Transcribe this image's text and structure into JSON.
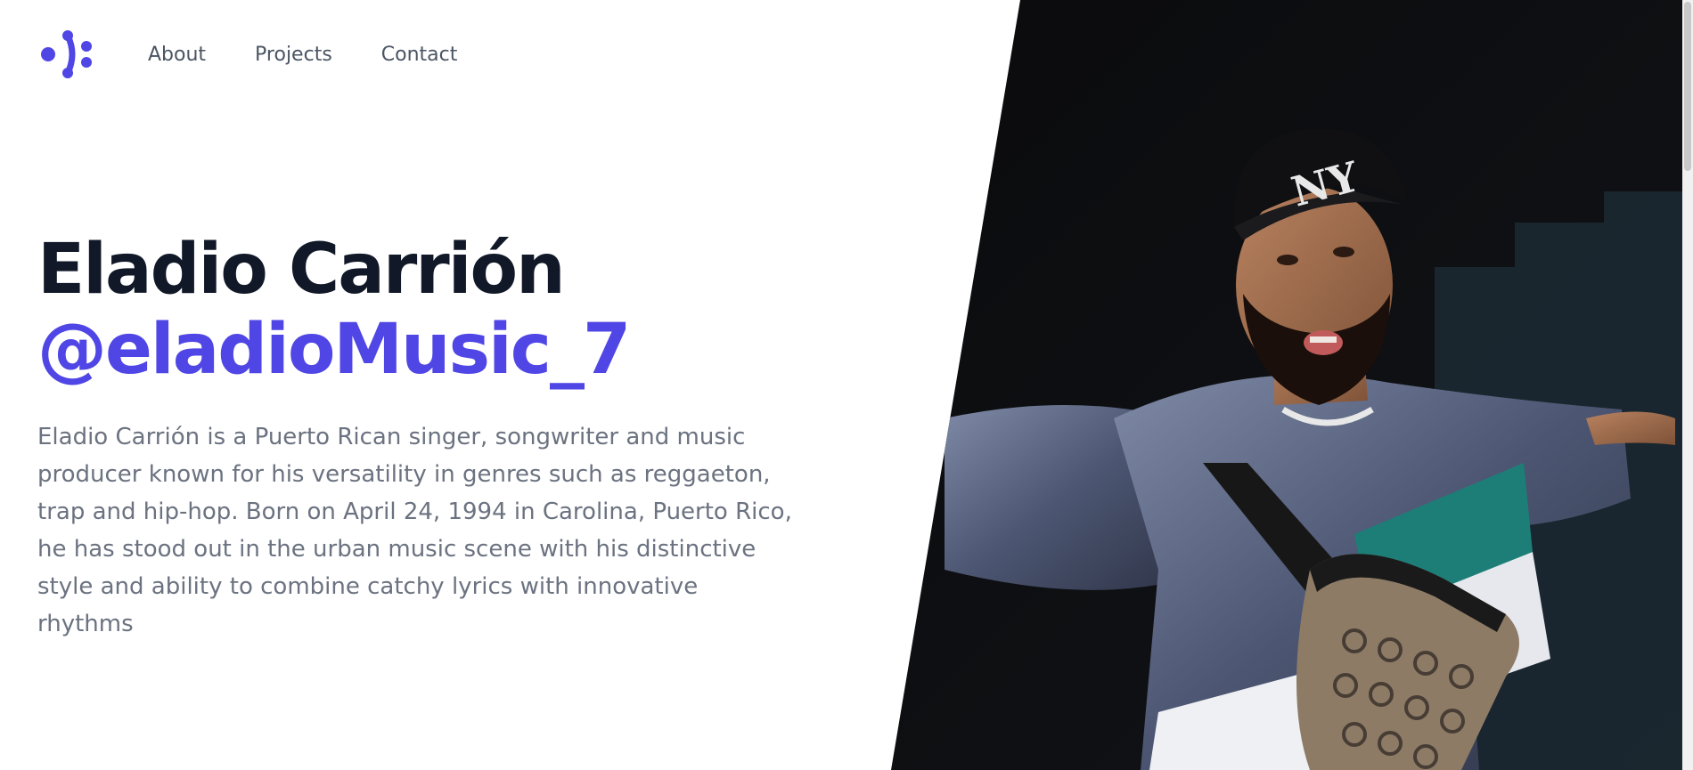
{
  "nav": {
    "logo_icon": "dots-logo-icon",
    "links": [
      {
        "label": "About"
      },
      {
        "label": "Projects"
      },
      {
        "label": "Contact"
      }
    ]
  },
  "hero": {
    "name": "Eladio Carrión",
    "handle": "@eladioMusic_7",
    "description": "Eladio Carrión is a Puerto Rican singer, songwriter and music producer known for his versatility in genres such as reggaeton, trap and hip-hop. Born on April 24, 1994 in Carolina, Puerto Rico, he has stood out in the urban music scene with his distinctive style and ability to combine catchy lyrics with innovative rhythms"
  },
  "colors": {
    "accent": "#4f46e5",
    "heading": "#111827",
    "body_text": "#6b7280"
  }
}
